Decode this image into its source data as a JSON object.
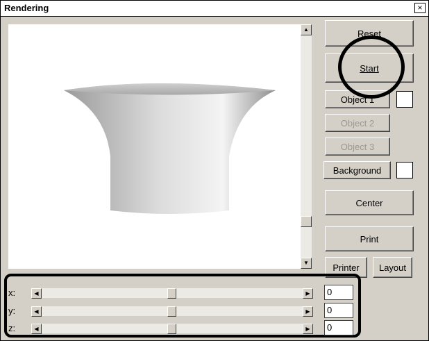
{
  "window": {
    "title": "Rendering",
    "close_symbol": "×"
  },
  "buttons": {
    "top_partial": "Reset",
    "start": "Start",
    "object1": "Object 1",
    "object2": "Object 2",
    "object3": "Object 3",
    "background": "Background",
    "center": "Center",
    "print": "Print",
    "printer": "Printer",
    "layout": "Layout"
  },
  "sliders": [
    {
      "label": "x:",
      "value": "0"
    },
    {
      "label": "y:",
      "value": "0"
    },
    {
      "label": "z:",
      "value": "0"
    }
  ],
  "colors": {
    "swatch_object1": "#ffffff",
    "swatch_background": "#ffffff"
  }
}
